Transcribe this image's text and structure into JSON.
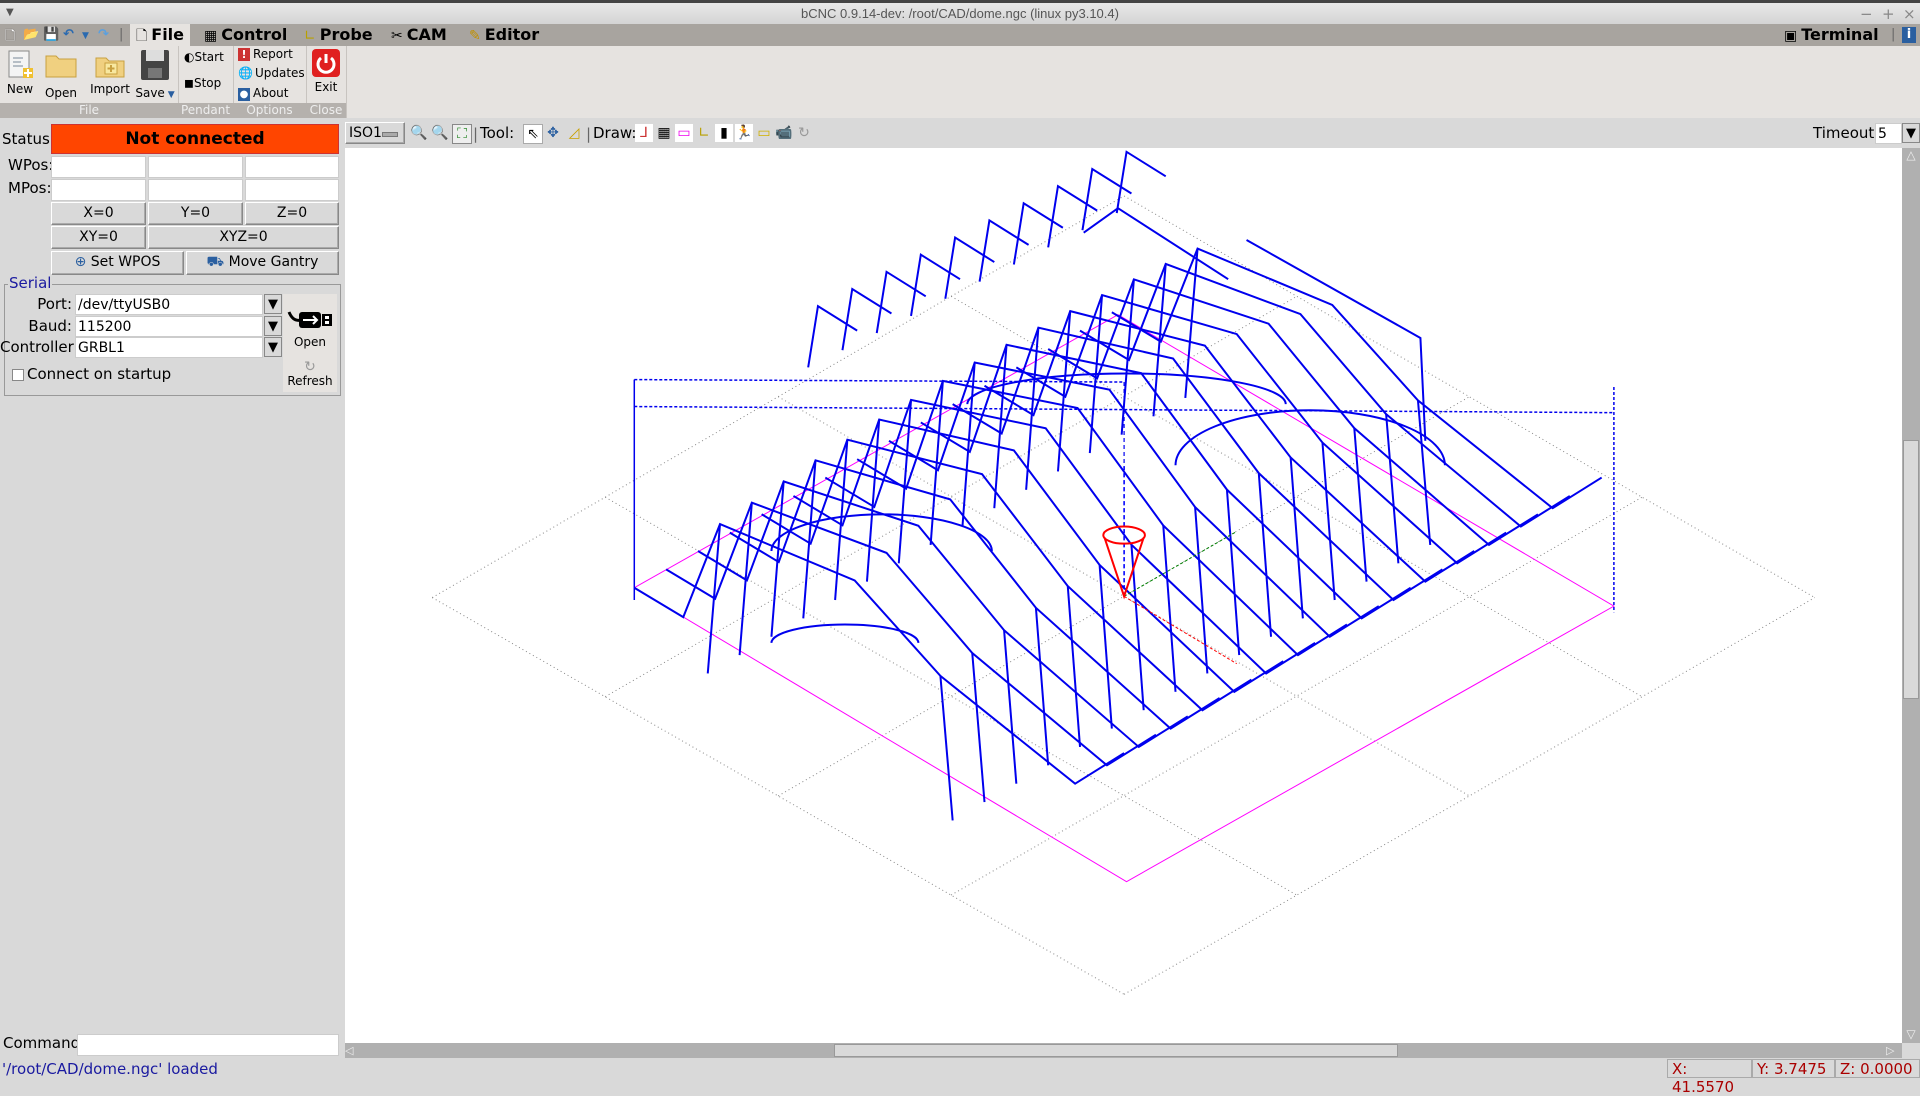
{
  "window": {
    "title": "bCNC 0.9.14-dev: /root/CAD/dome.ngc (linux py3.10.4)",
    "controls": [
      "−",
      "+",
      "×"
    ]
  },
  "quick_access": [
    "new-file-icon",
    "open-file-icon",
    "save-icon",
    "undo-icon",
    "undo-dropdown-icon",
    "redo-icon"
  ],
  "tabs": [
    {
      "label": "File",
      "icon": "file-icon",
      "active": true
    },
    {
      "label": "Control",
      "icon": "control-icon",
      "active": false
    },
    {
      "label": "Probe",
      "icon": "probe-icon",
      "active": false
    },
    {
      "label": "CAM",
      "icon": "cam-icon",
      "active": false
    },
    {
      "label": "Editor",
      "icon": "editor-icon",
      "active": false
    }
  ],
  "tabs_right": {
    "terminal": "Terminal",
    "info_icon": "info-icon"
  },
  "ribbon": {
    "groups": {
      "file": "File",
      "pendant": "Pendant",
      "options": "Options",
      "close": "Close"
    },
    "file_buttons": {
      "new": "New",
      "open": "Open",
      "import": "Import",
      "save": "Save"
    },
    "pendant_buttons": {
      "start": "Start",
      "stop": "Stop"
    },
    "options_buttons": {
      "report": "Report",
      "updates": "Updates",
      "about": "About"
    },
    "close_buttons": {
      "exit": "Exit"
    }
  },
  "dro": {
    "status_label": "Status:",
    "status_value": "Not connected",
    "status_color": "#ff4500",
    "wpos_label": "WPos:",
    "mpos_label": "MPos:",
    "wpos": [
      "",
      "",
      ""
    ],
    "mpos": [
      "",
      "",
      ""
    ],
    "buttons": {
      "x0": "X=0",
      "y0": "Y=0",
      "z0": "Z=0",
      "xy0": "XY=0",
      "xyz0": "XYZ=0",
      "set_wpos": "Set WPOS",
      "move_gantry": "Move Gantry"
    }
  },
  "serial": {
    "legend": "Serial",
    "port_label": "Port:",
    "port_value": "/dev/ttyUSB0",
    "baud_label": "Baud:",
    "baud_value": "115200",
    "controller_label": "Controller:",
    "controller_value": "GRBL1",
    "connect_on_startup_label": "Connect on startup",
    "connect_on_startup": false,
    "open_label": "Open",
    "refresh_label": "Refresh"
  },
  "command": {
    "label": "Command:",
    "value": ""
  },
  "canvas_toolbar": {
    "view": "ISO1",
    "tool_label": "Tool:",
    "draw_label": "Draw:",
    "timeout_label": "Timeout:",
    "timeout_value": "5",
    "zoom_icons": [
      "zoom-in-icon",
      "zoom-out-icon",
      "zoom-fit-icon"
    ],
    "tool_icons": [
      "select-icon",
      "pan-icon",
      "ruler-icon"
    ],
    "draw_icons": [
      "axes-icon",
      "grid-icon",
      "margins-icon",
      "workarea-icon",
      "probe-draw-icon",
      "rapid-icon",
      "paths-icon",
      "camera-icon",
      "refresh-icon"
    ]
  },
  "status_bar": {
    "message": "'/root/CAD/dome.ngc' loaded",
    "x": "X: 41.5570",
    "y": "Y: 3.7475",
    "z": "Z: 0.0000"
  },
  "scroll": {
    "vertical_fraction": [
      0.32,
      0.62
    ],
    "horizontal_fraction": [
      0.31,
      0.68
    ]
  },
  "colors": {
    "toolpath": "#0000ee",
    "margin": "#ff00ff",
    "tool": "#ff0000",
    "x_axis": "#ff0000",
    "y_axis": "#008000",
    "z_axis": "#0000ff",
    "grid": "#888888"
  }
}
